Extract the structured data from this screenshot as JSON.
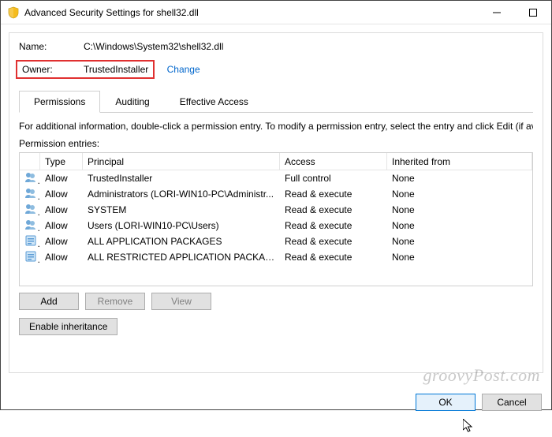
{
  "window": {
    "title": "Advanced Security Settings for shell32.dll"
  },
  "fields": {
    "name_label": "Name:",
    "name_value": "C:\\Windows\\System32\\shell32.dll",
    "owner_label": "Owner:",
    "owner_value": "TrustedInstaller",
    "change_link": "Change"
  },
  "tabs": {
    "permissions": "Permissions",
    "auditing": "Auditing",
    "effective": "Effective Access"
  },
  "info_line": "For additional information, double-click a permission entry. To modify a permission entry, select the entry and click Edit (if availa",
  "entries_label": "Permission entries:",
  "columns": {
    "type": "Type",
    "principal": "Principal",
    "access": "Access",
    "inherited": "Inherited from"
  },
  "entries": [
    {
      "icon": "group",
      "type": "Allow",
      "principal": "TrustedInstaller",
      "access": "Full control",
      "inherited": "None"
    },
    {
      "icon": "group",
      "type": "Allow",
      "principal": "Administrators (LORI-WIN10-PC\\Administr...",
      "access": "Read & execute",
      "inherited": "None"
    },
    {
      "icon": "group",
      "type": "Allow",
      "principal": "SYSTEM",
      "access": "Read & execute",
      "inherited": "None"
    },
    {
      "icon": "group",
      "type": "Allow",
      "principal": "Users (LORI-WIN10-PC\\Users)",
      "access": "Read & execute",
      "inherited": "None"
    },
    {
      "icon": "package",
      "type": "Allow",
      "principal": "ALL APPLICATION PACKAGES",
      "access": "Read & execute",
      "inherited": "None"
    },
    {
      "icon": "package",
      "type": "Allow",
      "principal": "ALL RESTRICTED APPLICATION PACKAGES",
      "access": "Read & execute",
      "inherited": "None"
    }
  ],
  "buttons": {
    "add": "Add",
    "remove": "Remove",
    "view": "View",
    "enable_inheritance": "Enable inheritance",
    "ok": "OK",
    "cancel": "Cancel"
  },
  "watermark": "groovyPost.com"
}
